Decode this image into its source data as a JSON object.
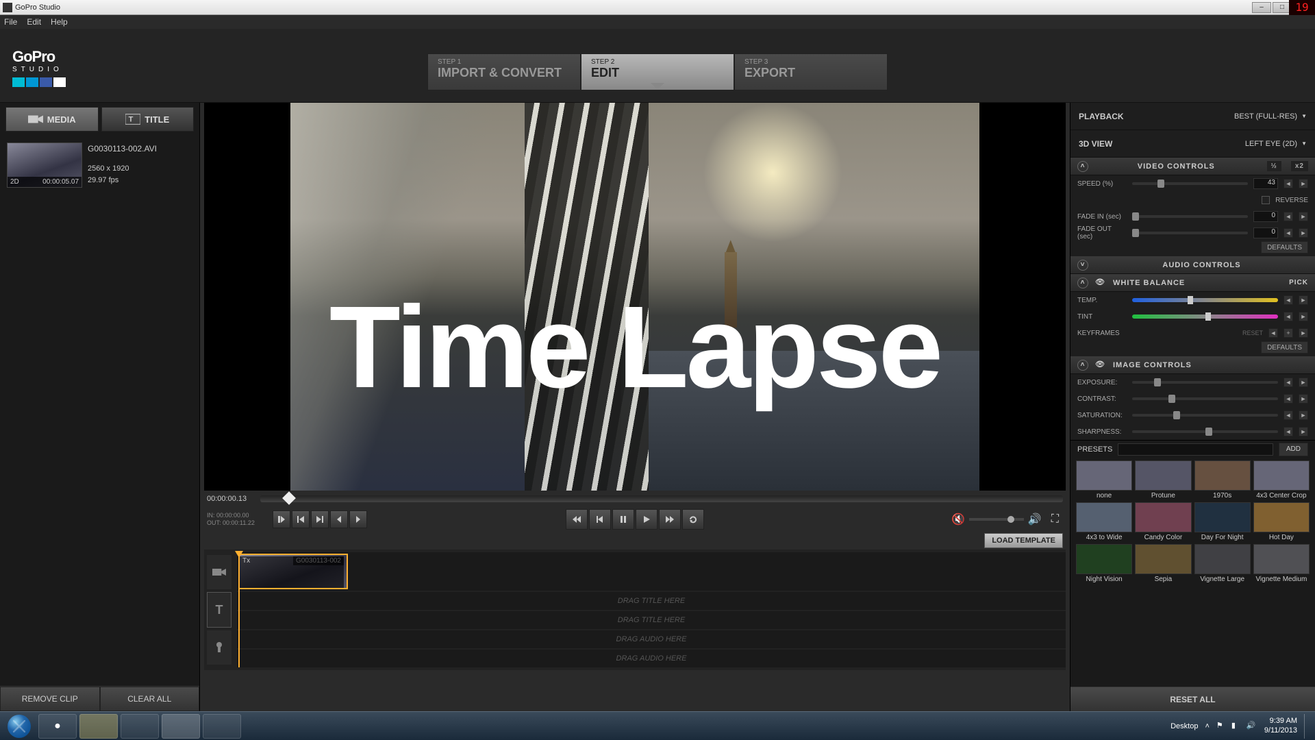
{
  "window": {
    "title": "GoPro Studio",
    "overclock": "19"
  },
  "menu": {
    "file": "File",
    "edit": "Edit",
    "help": "Help"
  },
  "logo": {
    "brand": "GoPro",
    "sub": "STUDIO",
    "colors": [
      "#00bcd4",
      "#0097d4",
      "#3a5aa8",
      "#ffffff"
    ]
  },
  "steps": [
    {
      "num": "STEP 1",
      "label": "IMPORT & CONVERT"
    },
    {
      "num": "STEP 2",
      "label": "EDIT"
    },
    {
      "num": "STEP 3",
      "label": "EXPORT"
    }
  ],
  "mediaTabs": {
    "media": "MEDIA",
    "title": "TITLE"
  },
  "clip": {
    "name": "G0030113-002.AVI",
    "res": "2560 x 1920",
    "fps": "29.97 fps",
    "badge2d": "2D",
    "dur": "00:00:05.07"
  },
  "leftButtons": {
    "remove": "REMOVE CLIP",
    "clear": "CLEAR ALL"
  },
  "preview": {
    "overlay": "Time Lapse"
  },
  "playhead": {
    "tc": "00:00:00.13"
  },
  "inout": {
    "in": "IN: 00:00:00.00",
    "out": "OUT: 00:00:11.22"
  },
  "loadTemplate": "LOAD TEMPLATE",
  "timeline": {
    "clipLabel": "G0030113-002",
    "tx": "Tx",
    "drag": [
      "DRAG TITLE HERE",
      "DRAG TITLE HERE",
      "DRAG AUDIO HERE",
      "DRAG AUDIO HERE"
    ]
  },
  "right": {
    "playback": {
      "label": "PLAYBACK",
      "value": "BEST (FULL-RES)"
    },
    "view3d": {
      "label": "3D VIEW",
      "value": "LEFT EYE (2D)"
    },
    "video": {
      "title": "VIDEO CONTROLS",
      "half": "½",
      "x2": "x2",
      "speed": {
        "label": "SPEED (%)",
        "val": "43"
      },
      "reverse": "REVERSE",
      "fadein": {
        "label": "FADE IN (sec)",
        "val": "0"
      },
      "fadeout": {
        "label": "FADE OUT (sec)",
        "val": "0"
      },
      "defaults": "DEFAULTS"
    },
    "audio": {
      "title": "AUDIO CONTROLS"
    },
    "wb": {
      "title": "WHITE BALANCE",
      "pick": "PICK",
      "temp": "TEMP.",
      "tint": "TINT",
      "kf": "KEYFRAMES",
      "reset": "RESET",
      "defaults": "DEFAULTS"
    },
    "image": {
      "title": "IMAGE CONTROLS",
      "exposure": "EXPOSURE:",
      "contrast": "CONTRAST:",
      "saturation": "SATURATION:",
      "sharpness": "SHARPNESS:"
    },
    "presets": {
      "label": "PRESETS",
      "add": "ADD",
      "items": [
        "none",
        "Protune",
        "1970s",
        "4x3 Center Crop",
        "4x3 to Wide",
        "Candy Color",
        "Day For Night",
        "Hot Day",
        "Night Vision",
        "Sepia",
        "Vignette Large",
        "Vignette Medium"
      ]
    },
    "resetAll": "RESET ALL"
  },
  "taskbar": {
    "desktop": "Desktop",
    "time": "9:39 AM",
    "date": "9/11/2013"
  },
  "presetColors": [
    "#667",
    "#556",
    "#665040",
    "#667",
    "#556070",
    "#704050",
    "#203040",
    "#806030",
    "#204020",
    "#605030",
    "#404044",
    "#505054"
  ]
}
